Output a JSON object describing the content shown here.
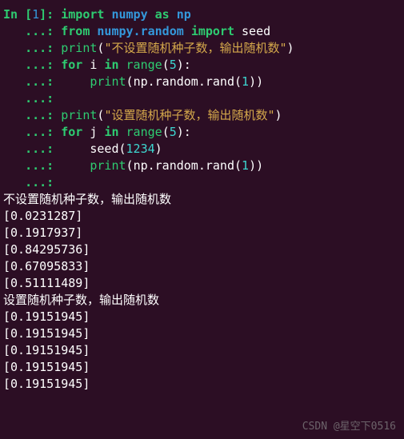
{
  "prompt": {
    "in_label": "In [",
    "in_num": "1",
    "in_close": "]: ",
    "dots": "   ...: "
  },
  "code": {
    "l1": {
      "imp": "import",
      "mod1": "numpy",
      "as": "as",
      "mod2": "np"
    },
    "l2": {
      "from": "from",
      "mod": "numpy.random",
      "imp": "import",
      "name": "seed"
    },
    "l3": {
      "fn": "print",
      "str": "\"不设置随机种子数，输出随机数\""
    },
    "l4": {
      "for": "for",
      "var": "i",
      "in": "in",
      "rng": "range",
      "arg": "5"
    },
    "l5": {
      "fn": "print",
      "obj": "np",
      "attr1": "random",
      "attr2": "rand",
      "arg": "1"
    },
    "l6": {
      "fn": "print",
      "str": "\"设置随机种子数，输出随机数\""
    },
    "l7": {
      "for": "for",
      "var": "j",
      "in": "in",
      "rng": "range",
      "arg": "5"
    },
    "l8": {
      "fn": "seed",
      "arg": "1234"
    },
    "l9": {
      "fn": "print",
      "obj": "np",
      "attr1": "random",
      "attr2": "rand",
      "arg": "1"
    }
  },
  "output": {
    "h1": "不设置随机种子数，输出随机数",
    "r1": "[0.0231287]",
    "r2": "[0.1917937]",
    "r3": "[0.84295736]",
    "r4": "[0.67095833]",
    "r5": "[0.51111489]",
    "h2": "设置随机种子数，输出随机数",
    "s1": "[0.19151945]",
    "s2": "[0.19151945]",
    "s3": "[0.19151945]",
    "s4": "[0.19151945]",
    "s5": "[0.19151945]"
  },
  "watermark": "CSDN @星空下0516"
}
